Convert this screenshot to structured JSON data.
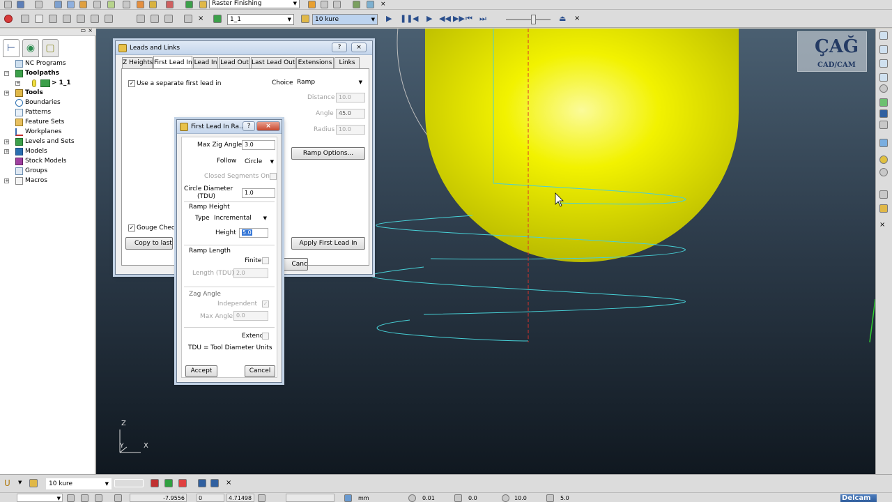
{
  "toolbar": {
    "strategy": "Raster Finishing",
    "toolpath_select": "1_1",
    "tool_select": "10 kure"
  },
  "explorer": {
    "items": [
      {
        "label": "NC Programs",
        "bold": false
      },
      {
        "label": "Toolpaths",
        "bold": true
      },
      {
        "label": "> 1_1",
        "bold": true
      },
      {
        "label": "Tools",
        "bold": true
      },
      {
        "label": "Boundaries",
        "bold": false
      },
      {
        "label": "Patterns",
        "bold": false
      },
      {
        "label": "Feature Sets",
        "bold": false
      },
      {
        "label": "Workplanes",
        "bold": false
      },
      {
        "label": "Levels and Sets",
        "bold": false
      },
      {
        "label": "Models",
        "bold": false
      },
      {
        "label": "Stock Models",
        "bold": false
      },
      {
        "label": "Groups",
        "bold": false
      },
      {
        "label": "Macros",
        "bold": false
      }
    ]
  },
  "logo": {
    "big": "ÇAĞ",
    "small": "CAD/CAM"
  },
  "axes": {
    "z": "Z",
    "y": "Y",
    "x": "X"
  },
  "leads_dialog": {
    "title": "Leads and Links",
    "help": "?",
    "close": "×",
    "tabs": [
      "Z Heights",
      "First Lead In",
      "Lead In",
      "Lead Out",
      "Last Lead Out",
      "Extensions",
      "Links"
    ],
    "separate_first_lead": "Use a separate first lead in",
    "choice_label": "Choice",
    "choice_value": "Ramp",
    "distance_label": "Distance",
    "distance_value": "10.0",
    "angle_label": "Angle",
    "angle_value": "45.0",
    "radius_label": "Radius",
    "radius_value": "10.0",
    "ramp_options": "Ramp Options...",
    "gouge_check": "Gouge Check",
    "copy_btn": "Copy to last lead",
    "apply_btn": "Apply First Lead In",
    "cancel_btn": "Cancel"
  },
  "ramp_dialog": {
    "title": "First Lead In Ra...",
    "help": "?",
    "close": "×",
    "max_zig_label": "Max Zig Angle",
    "max_zig_value": "3.0",
    "follow_label": "Follow",
    "follow_value": "Circle",
    "closed_segments": "Closed Segments Only",
    "circle_diameter_label": "Circle Diameter",
    "tdu_label": "(TDU)",
    "circle_diameter_value": "1.0",
    "ramp_height": "Ramp Height",
    "type_label": "Type",
    "type_value": "Incremental",
    "height_label": "Height",
    "height_value": "5.0",
    "ramp_length": "Ramp Length",
    "finite": "Finite",
    "length_label": "Length (TDU)",
    "length_value": "2.0",
    "zag_angle": "Zag Angle",
    "independent": "Independent",
    "max_angle_label": "Max Angle",
    "max_angle_value": "0.0",
    "extend": "Extend",
    "tdu_note": "TDU = Tool Diameter Units",
    "accept": "Accept",
    "cancel": "Cancel"
  },
  "status": {
    "tool_select": "10 kure",
    "coord_x": "-7.9556",
    "coord_y": "0",
    "coord_z": "4.71498",
    "units": "mm",
    "tolerance": "0.01",
    "thickness": "0.0",
    "diameter": "10.0",
    "stepover": "5.0",
    "brand": "Delcam"
  },
  "colors": {
    "viewport_top": "#4a5f71",
    "viewport_bottom": "#101820",
    "tool_yellow": "#f2f200",
    "toolpath_cyan": "#47d0d6",
    "centerline_red": "#d8302a"
  }
}
